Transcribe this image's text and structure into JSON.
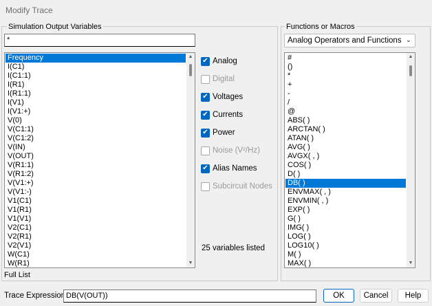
{
  "window": {
    "title": "Modify Trace"
  },
  "left_panel": {
    "header": "Simulation Output Variables",
    "filter_value": "*",
    "variables": [
      "Frequency",
      "I(C1)",
      "I(C1:1)",
      "I(R1)",
      "I(R1:1)",
      "I(V1)",
      "I(V1:+)",
      "V(0)",
      "V(C1:1)",
      "V(C1:2)",
      "V(IN)",
      "V(OUT)",
      "V(R1:1)",
      "V(R1:2)",
      "V(V1:+)",
      "V(V1:-)",
      "V1(C1)",
      "V1(R1)",
      "V1(V1)",
      "V2(C1)",
      "V2(R1)",
      "V2(V1)",
      "W(C1)",
      "W(R1)"
    ],
    "selected_index": 0,
    "footer": "Full List"
  },
  "options": {
    "analog": "Analog",
    "digital": "Digital",
    "voltages": "Voltages",
    "currents": "Currents",
    "power": "Power",
    "noise": "Noise (V²/Hz)",
    "alias_names": "Alias Names",
    "subcircuit_nodes": "Subcircuit Nodes",
    "count_text": "25 variables listed"
  },
  "right_panel": {
    "header": "Functions or Macros",
    "dropdown_value": "Analog Operators and Functions",
    "functions": [
      "#",
      "()",
      "*",
      "+",
      "-",
      "/",
      "@",
      "ABS( )",
      "ARCTAN( )",
      "ATAN( )",
      "AVG( )",
      "AVGX( , )",
      "COS( )",
      "D( )",
      "DB( )",
      "ENVMAX( , )",
      "ENVMIN( , )",
      "EXP( )",
      "G( )",
      "IMG( )",
      "LOG( )",
      "LOG10( )",
      "M( )",
      "MAX( )"
    ],
    "selected_index": 14
  },
  "bottom": {
    "trace_label": "Trace Expression:",
    "trace_value": "DB(V(OUT))",
    "ok": "OK",
    "cancel": "Cancel",
    "help": "Help"
  }
}
